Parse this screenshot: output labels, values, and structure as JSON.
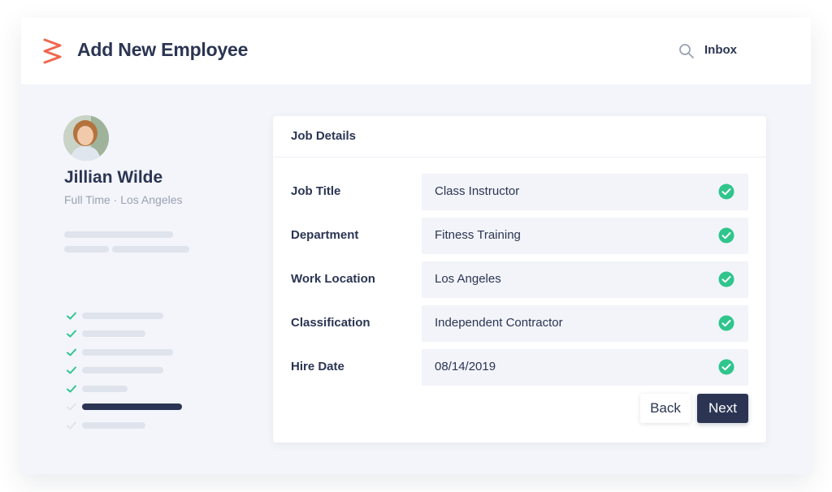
{
  "colors": {
    "brand": "#f0674f",
    "navy": "#2b3553",
    "success": "#2fc58c",
    "background": "#f3f5fa",
    "placeholder": "#dfe3ec"
  },
  "header": {
    "title": "Add New Employee",
    "inbox_label": "Inbox",
    "logo_icon": "zigzag-logo-icon",
    "search_icon": "search-icon"
  },
  "profile": {
    "name": "Jillian Wilde",
    "subtitle": "Full Time · Los Angeles",
    "avatar_icon": "avatar-photo"
  },
  "steps": [
    {
      "status": "complete"
    },
    {
      "status": "complete"
    },
    {
      "status": "complete"
    },
    {
      "status": "complete"
    },
    {
      "status": "complete"
    },
    {
      "status": "current"
    },
    {
      "status": "pending"
    }
  ],
  "job_details": {
    "title": "Job Details",
    "fields": [
      {
        "label": "Job Title",
        "value": "Class Instructor",
        "valid": true
      },
      {
        "label": "Department",
        "value": "Fitness Training",
        "valid": true
      },
      {
        "label": "Work Location",
        "value": "Los Angeles",
        "valid": true
      },
      {
        "label": "Classification",
        "value": "Independent Contractor",
        "valid": true
      },
      {
        "label": "Hire Date",
        "value": "08/14/2019",
        "valid": true
      }
    ],
    "back_label": "Back",
    "next_label": "Next"
  }
}
